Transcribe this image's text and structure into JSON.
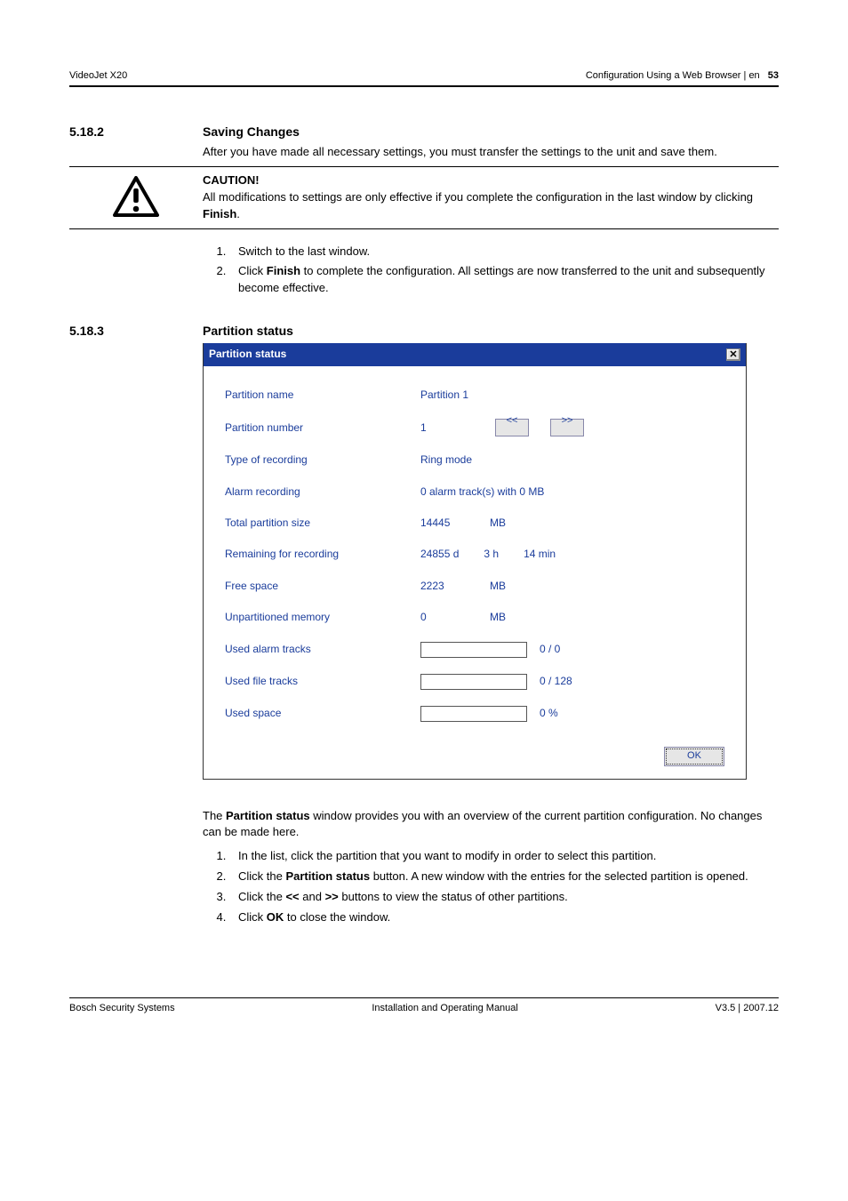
{
  "header": {
    "left": "VideoJet X20",
    "right_text": "Configuration Using a Web Browser | en",
    "page_num": "53"
  },
  "section1": {
    "num": "5.18.2",
    "title": "Saving Changes",
    "intro": "After you have made all necessary settings, you must transfer the settings to the unit and save them."
  },
  "caution": {
    "label": "CAUTION!",
    "text_pre": "All modifications to settings are only effective if you complete the configuration in the last window by clicking ",
    "finish": "Finish",
    "text_post": "."
  },
  "steps1": {
    "s1": "Switch to the last window.",
    "s2a": "Click ",
    "s2b": "Finish",
    "s2c": " to complete the configuration. All settings are now transferred to the unit and subsequently become effective."
  },
  "section2": {
    "num": "5.18.3",
    "title": "Partition status"
  },
  "dialog": {
    "title": "Partition status",
    "close_icon": "✕",
    "rows": {
      "partition_name": {
        "label": "Partition name",
        "value": "Partition 1"
      },
      "partition_number": {
        "label": "Partition number",
        "value": "1",
        "prev": "<<",
        "next": ">>"
      },
      "type_recording": {
        "label": "Type of recording",
        "value": "Ring mode"
      },
      "alarm_recording": {
        "label": "Alarm recording",
        "value": "0 alarm track(s) with 0 MB"
      },
      "total_size": {
        "label": "Total partition size",
        "num": "14445",
        "unit": "MB"
      },
      "remaining": {
        "label": "Remaining for recording",
        "d": "24855 d",
        "h": "3 h",
        "m": "14 min"
      },
      "free_space": {
        "label": "Free space",
        "num": "2223",
        "unit": "MB"
      },
      "unpartitioned": {
        "label": "Unpartitioned memory",
        "num": "0",
        "unit": "MB"
      },
      "used_alarm": {
        "label": "Used alarm tracks",
        "value": "0 / 0"
      },
      "used_file": {
        "label": "Used file tracks",
        "value": "0 / 128"
      },
      "used_space": {
        "label": "Used space",
        "value": "0 %"
      }
    },
    "ok": "OK"
  },
  "after": {
    "p1a": "The ",
    "p1b": "Partition status",
    "p1c": " window provides you with an overview of the current partition configuration. No changes can be made here.",
    "s1": "In the list, click the partition that you want to modify in order to select this partition.",
    "s2a": "Click the ",
    "s2b": "Partition status",
    "s2c": " button. A new window with the entries for the selected partition is opened.",
    "s3a": "Click the ",
    "s3b": "<<",
    "s3c": " and ",
    "s3d": ">>",
    "s3e": " buttons to view the status of other partitions.",
    "s4a": "Click ",
    "s4b": "OK",
    "s4c": " to close the window."
  },
  "footer": {
    "left": "Bosch Security Systems",
    "center": "Installation and Operating Manual",
    "right": "V3.5 | 2007.12"
  }
}
